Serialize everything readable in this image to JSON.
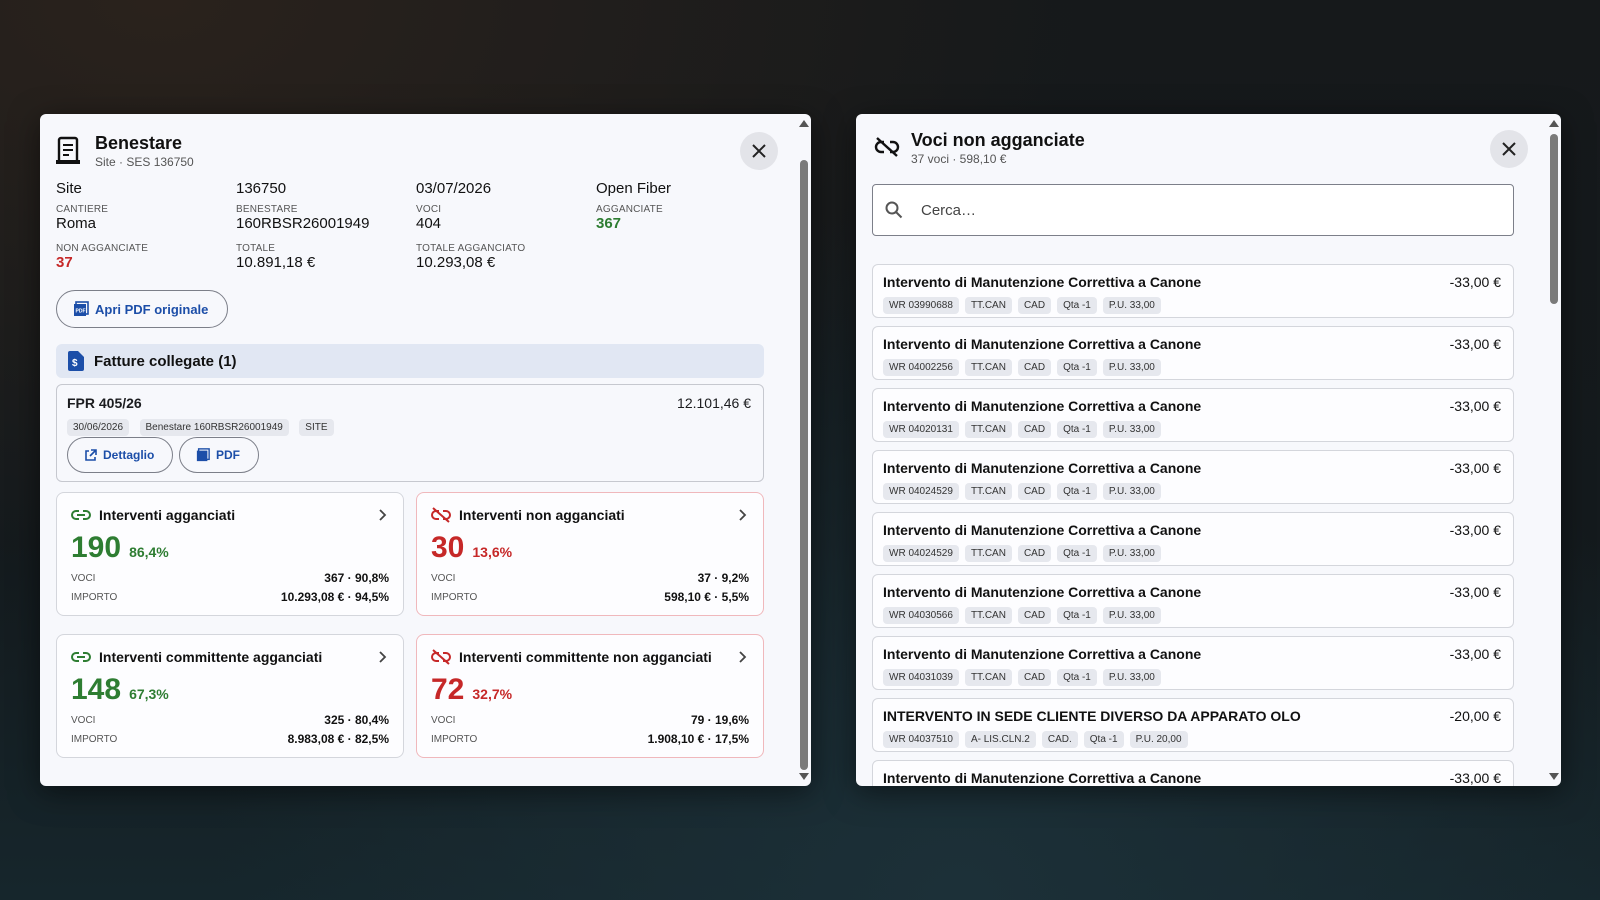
{
  "left": {
    "title": "Benestare",
    "subtitle": "Site · SES 136750",
    "info": {
      "row1": [
        "Site",
        "136750",
        "03/07/2026",
        "Open Fiber"
      ],
      "cantiere_label": "CANTIERE",
      "cantiere_value": "Roma",
      "benestare_label": "BENESTARE",
      "benestare_value": "160RBSR26001949",
      "voci_label": "VOCI",
      "voci_value": "404",
      "agganciate_label": "AGGANCIATE",
      "agganciate_value": "367",
      "non_agganciate_label": "NON AGGANCIATE",
      "non_agganciate_value": "37",
      "totale_label": "TOTALE",
      "totale_value": "10.891,18 €",
      "totale_agganciato_label": "TOTALE AGGANCIATO",
      "totale_agganciato_value": "10.293,08 €"
    },
    "open_pdf_label": "Apri PDF originale",
    "fatture_title": "Fatture collegate (1)",
    "invoice": {
      "number": "FPR 405/26",
      "amount": "12.101,46 €",
      "chips": [
        "30/06/2026",
        "Benestare 160RBSR26001949",
        "SITE"
      ],
      "detail_label": "Dettaglio",
      "pdf_label": "PDF"
    },
    "stats": [
      {
        "title": "Interventi agganciati",
        "num": "190",
        "pct": "86,4%",
        "voci_label": "VOCI",
        "voci": "367 · 90,8%",
        "importo_label": "IMPORTO",
        "importo": "10.293,08 € · 94,5%",
        "status": "linked"
      },
      {
        "title": "Interventi non agganciati",
        "num": "30",
        "pct": "13,6%",
        "voci_label": "VOCI",
        "voci": "37 · 9,2%",
        "importo_label": "IMPORTO",
        "importo": "598,10 € · 5,5%",
        "status": "unlinked"
      },
      {
        "title": "Interventi committente agganciati",
        "num": "148",
        "pct": "67,3%",
        "voci_label": "VOCI",
        "voci": "325 · 80,4%",
        "importo_label": "IMPORTO",
        "importo": "8.983,08 € · 82,5%",
        "status": "linked"
      },
      {
        "title": "Interventi committente non agganciati",
        "num": "72",
        "pct": "32,7%",
        "voci_label": "VOCI",
        "voci": "79 · 19,6%",
        "importo_label": "IMPORTO",
        "importo": "1.908,10 € · 17,5%",
        "status": "unlinked"
      }
    ]
  },
  "right": {
    "title": "Voci non agganciate",
    "subtitle": "37 voci · 598,10 €",
    "search_placeholder": "Cerca…",
    "items": [
      {
        "title": "Intervento di Manutenzione Correttiva a Canone",
        "amount": "-33,00 €",
        "chips": [
          "WR 03990688",
          "TT.CAN",
          "CAD",
          "Qta -1",
          "P.U. 33,00"
        ]
      },
      {
        "title": "Intervento di Manutenzione Correttiva a Canone",
        "amount": "-33,00 €",
        "chips": [
          "WR 04002256",
          "TT.CAN",
          "CAD",
          "Qta -1",
          "P.U. 33,00"
        ]
      },
      {
        "title": "Intervento di Manutenzione Correttiva a Canone",
        "amount": "-33,00 €",
        "chips": [
          "WR 04020131",
          "TT.CAN",
          "CAD",
          "Qta -1",
          "P.U. 33,00"
        ]
      },
      {
        "title": "Intervento di Manutenzione Correttiva a Canone",
        "amount": "-33,00 €",
        "chips": [
          "WR 04024529",
          "TT.CAN",
          "CAD",
          "Qta -1",
          "P.U. 33,00"
        ]
      },
      {
        "title": "Intervento di Manutenzione Correttiva a Canone",
        "amount": "-33,00 €",
        "chips": [
          "WR 04024529",
          "TT.CAN",
          "CAD",
          "Qta -1",
          "P.U. 33,00"
        ]
      },
      {
        "title": "Intervento di Manutenzione Correttiva a Canone",
        "amount": "-33,00 €",
        "chips": [
          "WR 04030566",
          "TT.CAN",
          "CAD",
          "Qta -1",
          "P.U. 33,00"
        ]
      },
      {
        "title": "Intervento di Manutenzione Correttiva a Canone",
        "amount": "-33,00 €",
        "chips": [
          "WR 04031039",
          "TT.CAN",
          "CAD",
          "Qta -1",
          "P.U. 33,00"
        ]
      },
      {
        "title": "INTERVENTO IN SEDE CLIENTE DIVERSO DA APPARATO OLO",
        "amount": "-20,00 €",
        "chips": [
          "WR 04037510",
          "A- LIS.CLN.2",
          "CAD.",
          "Qta -1",
          "P.U. 20,00"
        ]
      },
      {
        "title": "Intervento di Manutenzione Correttiva a Canone",
        "amount": "-33,00 €",
        "chips": []
      }
    ]
  },
  "colors": {
    "green": "#2e7d32",
    "red": "#c62828",
    "link_blue": "#1c4ea8"
  }
}
